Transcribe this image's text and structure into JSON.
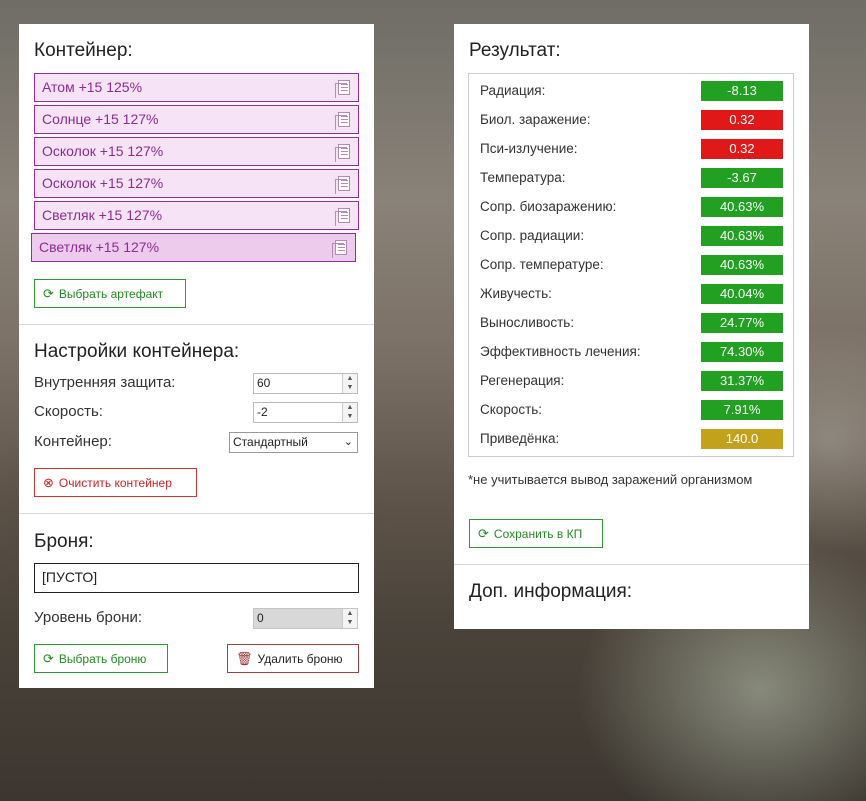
{
  "container": {
    "title": "Контейнер:",
    "artifacts": [
      {
        "label": "Атом +15 125%"
      },
      {
        "label": "Солнце +15 127%"
      },
      {
        "label": "Осколок +15 127%"
      },
      {
        "label": "Осколок +15 127%"
      },
      {
        "label": "Светляк +15 127%"
      },
      {
        "label": "Светляк +15 127%"
      }
    ],
    "select_artifact_button": "Выбрать артефакт"
  },
  "settings": {
    "title": "Настройки контейнера:",
    "inner_protection_label": "Внутренняя защита:",
    "inner_protection_value": "60",
    "speed_label": "Скорость:",
    "speed_value": "-2",
    "container_label": "Контейнер:",
    "container_value": "Стандартный",
    "clear_button": "Очистить контейнер"
  },
  "armor": {
    "title": "Броня:",
    "value": "[ПУСТО]",
    "level_label": "Уровень брони:",
    "level_value": "0",
    "select_button": "Выбрать броню",
    "delete_button": "Удалить броню"
  },
  "result": {
    "title": "Результат:",
    "rows": [
      {
        "label": "Радиация:",
        "value": "-8.13",
        "color": "#21a021"
      },
      {
        "label": "Биол. заражение:",
        "value": "0.32",
        "color": "#e01818"
      },
      {
        "label": "Пси-излучение:",
        "value": "0.32",
        "color": "#e01818"
      },
      {
        "label": "Температура:",
        "value": "-3.67",
        "color": "#21a021"
      },
      {
        "label": "Сопр. биозаражению:",
        "value": "40.63%",
        "color": "#21a021"
      },
      {
        "label": "Сопр. радиации:",
        "value": "40.63%",
        "color": "#21a021"
      },
      {
        "label": "Сопр. температуре:",
        "value": "40.63%",
        "color": "#21a021"
      },
      {
        "label": "Живучесть:",
        "value": "40.04%",
        "color": "#21a021"
      },
      {
        "label": "Выносливость:",
        "value": "24.77%",
        "color": "#21a021"
      },
      {
        "label": "Эффективность лечения:",
        "value": "74.30%",
        "color": "#21a021"
      },
      {
        "label": "Регенерация:",
        "value": "31.37%",
        "color": "#21a021"
      },
      {
        "label": "Скорость:",
        "value": "7.91%",
        "color": "#21a021"
      },
      {
        "label": "Приведёнка:",
        "value": "140.0",
        "color": "#c2a21c"
      }
    ],
    "note": "*не учитывается вывод заражений организмом",
    "save_button": "Сохранить в КП",
    "extra_title": "Доп. информация:"
  }
}
